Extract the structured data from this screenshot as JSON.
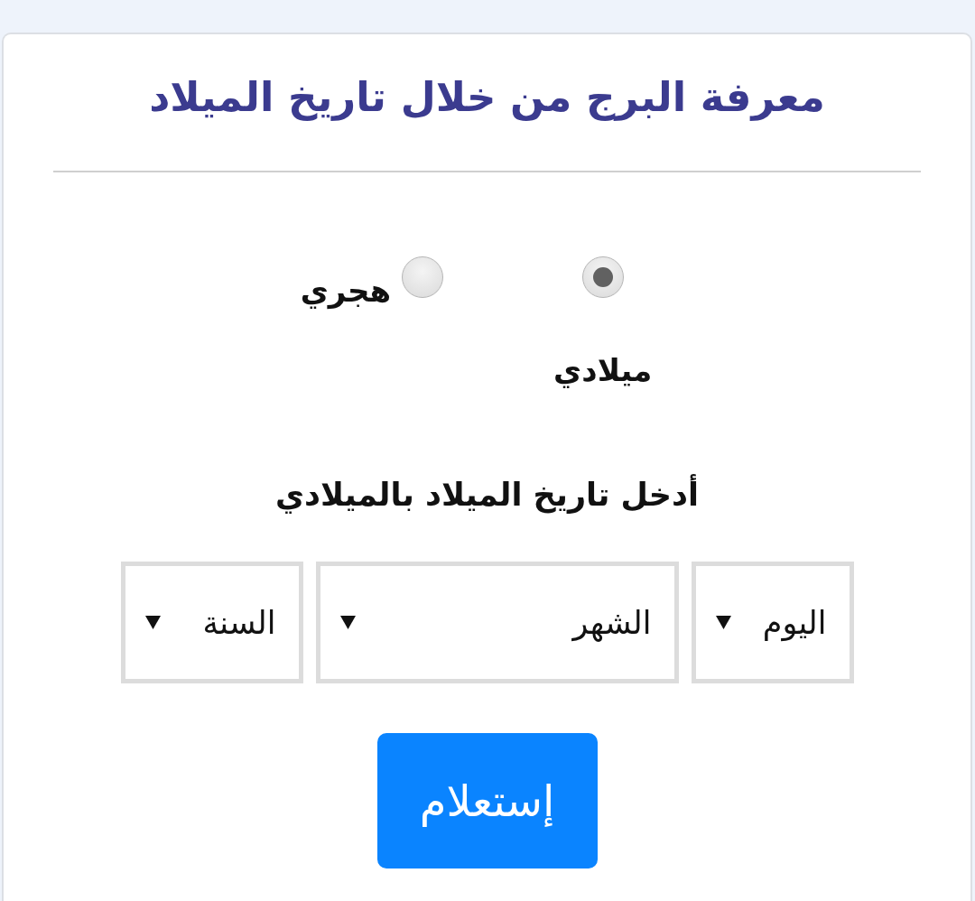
{
  "title": "معرفة البرج من خلال تاريخ الميلاد",
  "calendar_options": [
    {
      "label": "ميلادي",
      "selected": true
    },
    {
      "label": "هجري",
      "selected": false
    }
  ],
  "prompt": "أدخل تاريخ الميلاد بالميلادي",
  "date_selects": [
    {
      "value": "اليوم"
    },
    {
      "value": "الشهر"
    },
    {
      "value": "السنة"
    }
  ],
  "submit_button": "إستعلام"
}
